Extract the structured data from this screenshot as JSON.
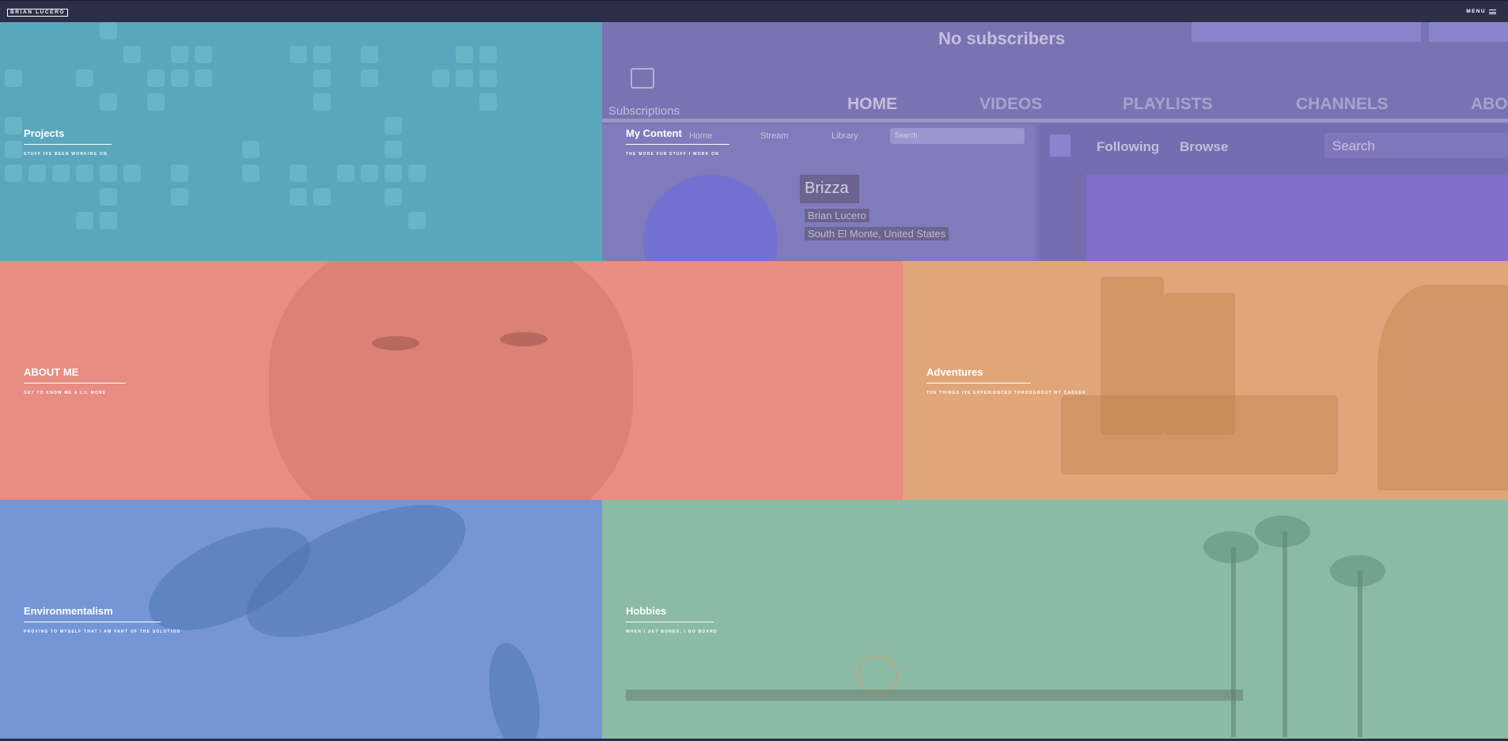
{
  "header": {
    "logo": "BRIAN LUCERO",
    "menu_label": "MENU",
    "menu_icon": "hamburger-icon"
  },
  "tiles": [
    {
      "title": "Projects",
      "subtitle": "STUFF IVE BEEN WORKING ON",
      "color": "#5aa7bd"
    },
    {
      "title": "My Content",
      "subtitle": "THE MORE FUN STUFF I WORK ON",
      "color": "#7a72b2"
    },
    {
      "title": "ABOUT ME",
      "subtitle": "GET TO KNOW ME A LIL MORE",
      "color": "#e78d82"
    },
    {
      "title": "Adventures",
      "subtitle": "THE THINGS IVE EXPERIENCED THROUGHOUT MY CAREER",
      "color": "#e0a679"
    },
    {
      "title": "Environmentalism",
      "subtitle": "PROVING TO MYSELF THAT I AM PART OF THE SOLUTION",
      "color": "#7695d6"
    },
    {
      "title": "Hobbies",
      "subtitle": "WHEN I GET BORED, I GO BOARD",
      "color": "#8bbba5"
    }
  ],
  "content_bg": {
    "subscriptions": "Subscriptions",
    "no_subscribers": "No subscribers",
    "tabs": [
      "HOME",
      "VIDEOS",
      "PLAYLISTS",
      "CHANNELS",
      "ABO"
    ],
    "mini_tabs": [
      "Home",
      "Stream",
      "Library"
    ],
    "search_small": "Search",
    "channel_name": "Brizza",
    "channel_user": "Brian Lucero",
    "channel_location": "South El Monte, United States",
    "twitch_following": "Following",
    "twitch_browse": "Browse",
    "twitch_search": "Search"
  }
}
